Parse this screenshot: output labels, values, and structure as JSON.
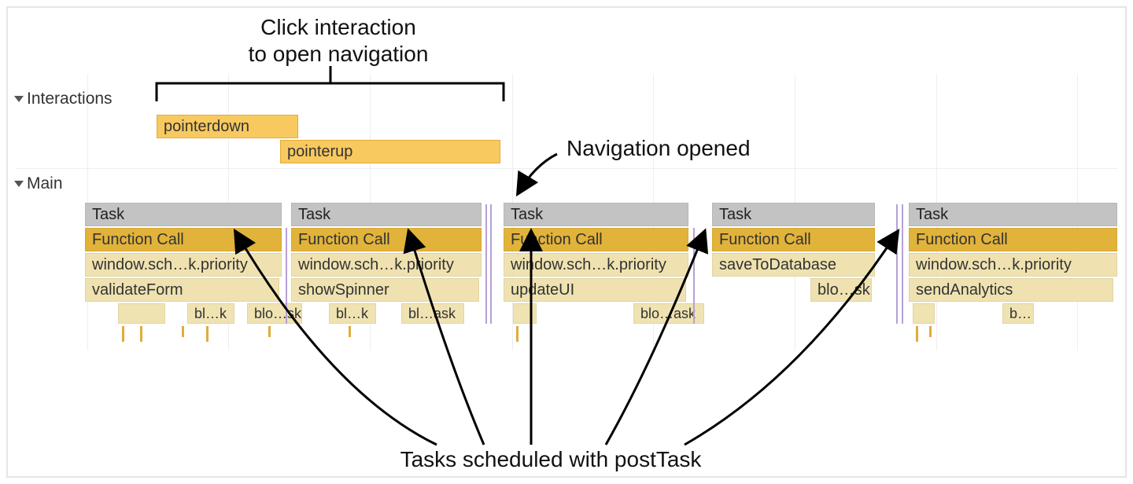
{
  "annotations": {
    "top": "Click interaction\nto open navigation",
    "nav_opened": "Navigation opened",
    "bottom": "Tasks scheduled with postTask"
  },
  "tracks": {
    "interactions": {
      "label": "Interactions",
      "events": {
        "pointerdown": "pointerdown",
        "pointerup": "pointerup"
      }
    },
    "main": {
      "label": "Main",
      "task_label": "Task",
      "funccall_label": "Function Call",
      "columns": [
        {
          "lvl3": "window.sch…k.priority",
          "lvl4": "validateForm",
          "subs": [
            "bl…k",
            "blo…sk"
          ]
        },
        {
          "lvl3": "window.sch…k.priority",
          "lvl4": "showSpinner",
          "subs": [
            "bl…k",
            "bl…ask"
          ]
        },
        {
          "lvl3": "window.sch…k.priority",
          "lvl4": "updateUI",
          "subs": [
            "blo…ask"
          ]
        },
        {
          "lvl3": "saveToDatabase",
          "lvl4": "blo…sk",
          "subs": []
        },
        {
          "lvl3": "window.sch…k.priority",
          "lvl4": "sendAnalytics",
          "subs": [
            "b…"
          ]
        }
      ]
    }
  }
}
